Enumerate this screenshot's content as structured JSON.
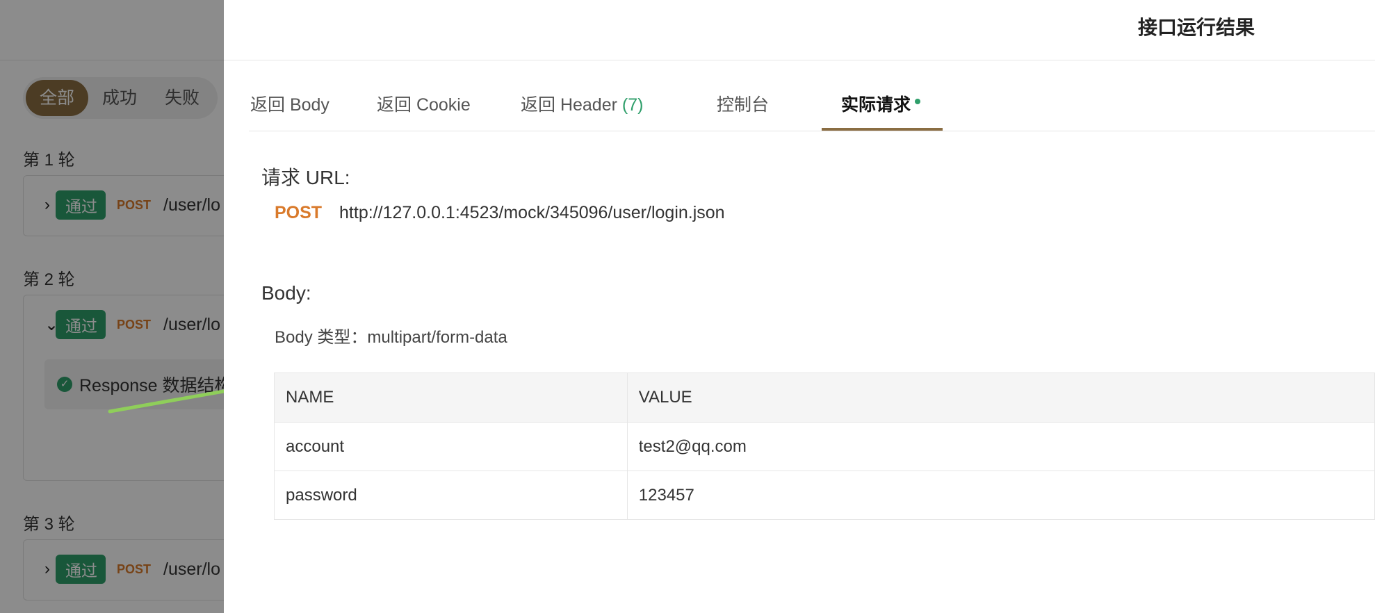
{
  "background": {
    "filters": [
      "全部",
      "成功",
      "失败"
    ],
    "active_filter": "全部",
    "rounds": [
      {
        "title": "第 1 轮",
        "status": "通过",
        "method": "POST",
        "path": "/user/lo"
      },
      {
        "title": "第 2 轮",
        "status": "通过",
        "method": "POST",
        "path": "/user/lo",
        "assertion": "Response 数据结构"
      },
      {
        "title": "第 3 轮",
        "status": "通过",
        "method": "POST",
        "path": "/user/lo"
      }
    ]
  },
  "drawer": {
    "title": "接口运行结果",
    "tabs": [
      {
        "label": "返回 Body"
      },
      {
        "label": "返回 Cookie"
      },
      {
        "label": "返回 Header ",
        "count": "(7)"
      },
      {
        "label": "控制台"
      },
      {
        "label": "实际请求",
        "active": true
      }
    ],
    "request": {
      "section_label": "请求 URL:",
      "method": "POST",
      "url": "http://127.0.0.1:4523/mock/345096/user/login.json"
    },
    "body": {
      "section_label": "Body:",
      "type_label": "Body 类型：multipart/form-data",
      "columns": [
        "NAME",
        "VALUE"
      ],
      "rows": [
        {
          "name": "account",
          "value": "test2@qq.com"
        },
        {
          "name": "password",
          "value": "123457"
        }
      ]
    }
  },
  "colors": {
    "accent": "#8a6d43",
    "success": "#2e9e6a",
    "method": "#d97a2b",
    "arrow": "#8fce5a"
  }
}
